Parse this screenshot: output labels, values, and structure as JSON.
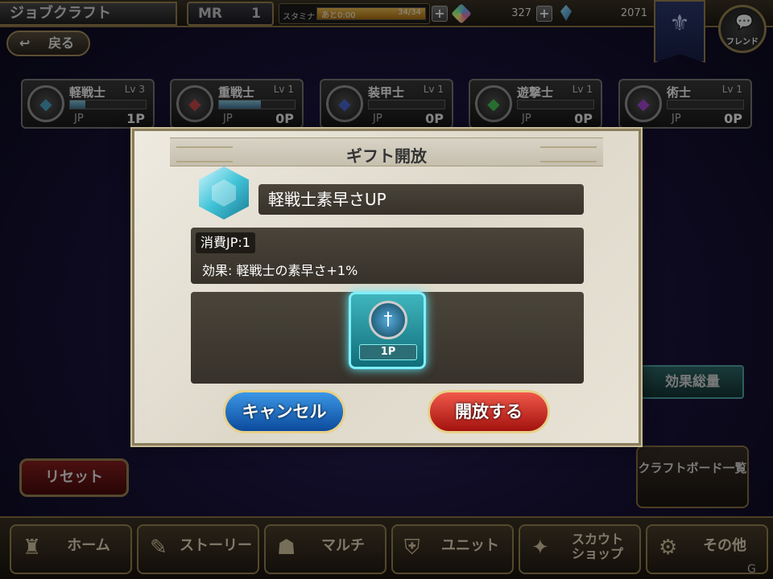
{
  "header": {
    "screen_title": "ジョブクラフト",
    "rank_label": "MR",
    "rank_value": "1",
    "stamina_label": "スタミナ",
    "stamina_recover": "あと0:00",
    "stamina_count": "34/34",
    "gem_count": "327",
    "crystal_count": "2071",
    "friend_label": "フレンド",
    "back_label": "戻る"
  },
  "jobs": [
    {
      "name": "軽戦士",
      "lv": "Lv 3",
      "jp_label": "JP",
      "jp": "1P",
      "icon": "shield-icon",
      "color": "#4aa8c8"
    },
    {
      "name": "重戦士",
      "lv": "Lv 1",
      "jp_label": "JP",
      "jp": "0P",
      "icon": "horned-helm-icon",
      "color": "#c84a4a"
    },
    {
      "name": "装甲士",
      "lv": "Lv 1",
      "jp_label": "JP",
      "jp": "0P",
      "icon": "armor-icon",
      "color": "#4a6ad8"
    },
    {
      "name": "遊撃士",
      "lv": "Lv 1",
      "jp_label": "JP",
      "jp": "0P",
      "icon": "bow-icon",
      "color": "#4ac85a"
    },
    {
      "name": "術士",
      "lv": "Lv 1",
      "jp_label": "JP",
      "jp": "0P",
      "icon": "magic-icon",
      "color": "#a84ad8"
    }
  ],
  "side": {
    "effect_total": "効果総量",
    "craft_board": "クラフトボード一覧",
    "reset": "リセット"
  },
  "nav": [
    {
      "label": "ホーム",
      "icon": "castle-icon"
    },
    {
      "label": "ストーリー",
      "icon": "book-icon"
    },
    {
      "label": "マルチ",
      "icon": "party-icon"
    },
    {
      "label": "ユニット",
      "icon": "helmet-icon"
    },
    {
      "label": "スカウト\nショップ",
      "icon": "scout-icon"
    },
    {
      "label": "その他",
      "icon": "gear-icon"
    }
  ],
  "modal": {
    "title": "ギフト開放",
    "gift_name": "軽戦士素早さUP",
    "cost": "消費JP:1",
    "effect": "効果: 軽戦士の素早さ+1%",
    "node_cost": "1P",
    "cancel_label": "キャンセル",
    "confirm_label": "開放する"
  }
}
